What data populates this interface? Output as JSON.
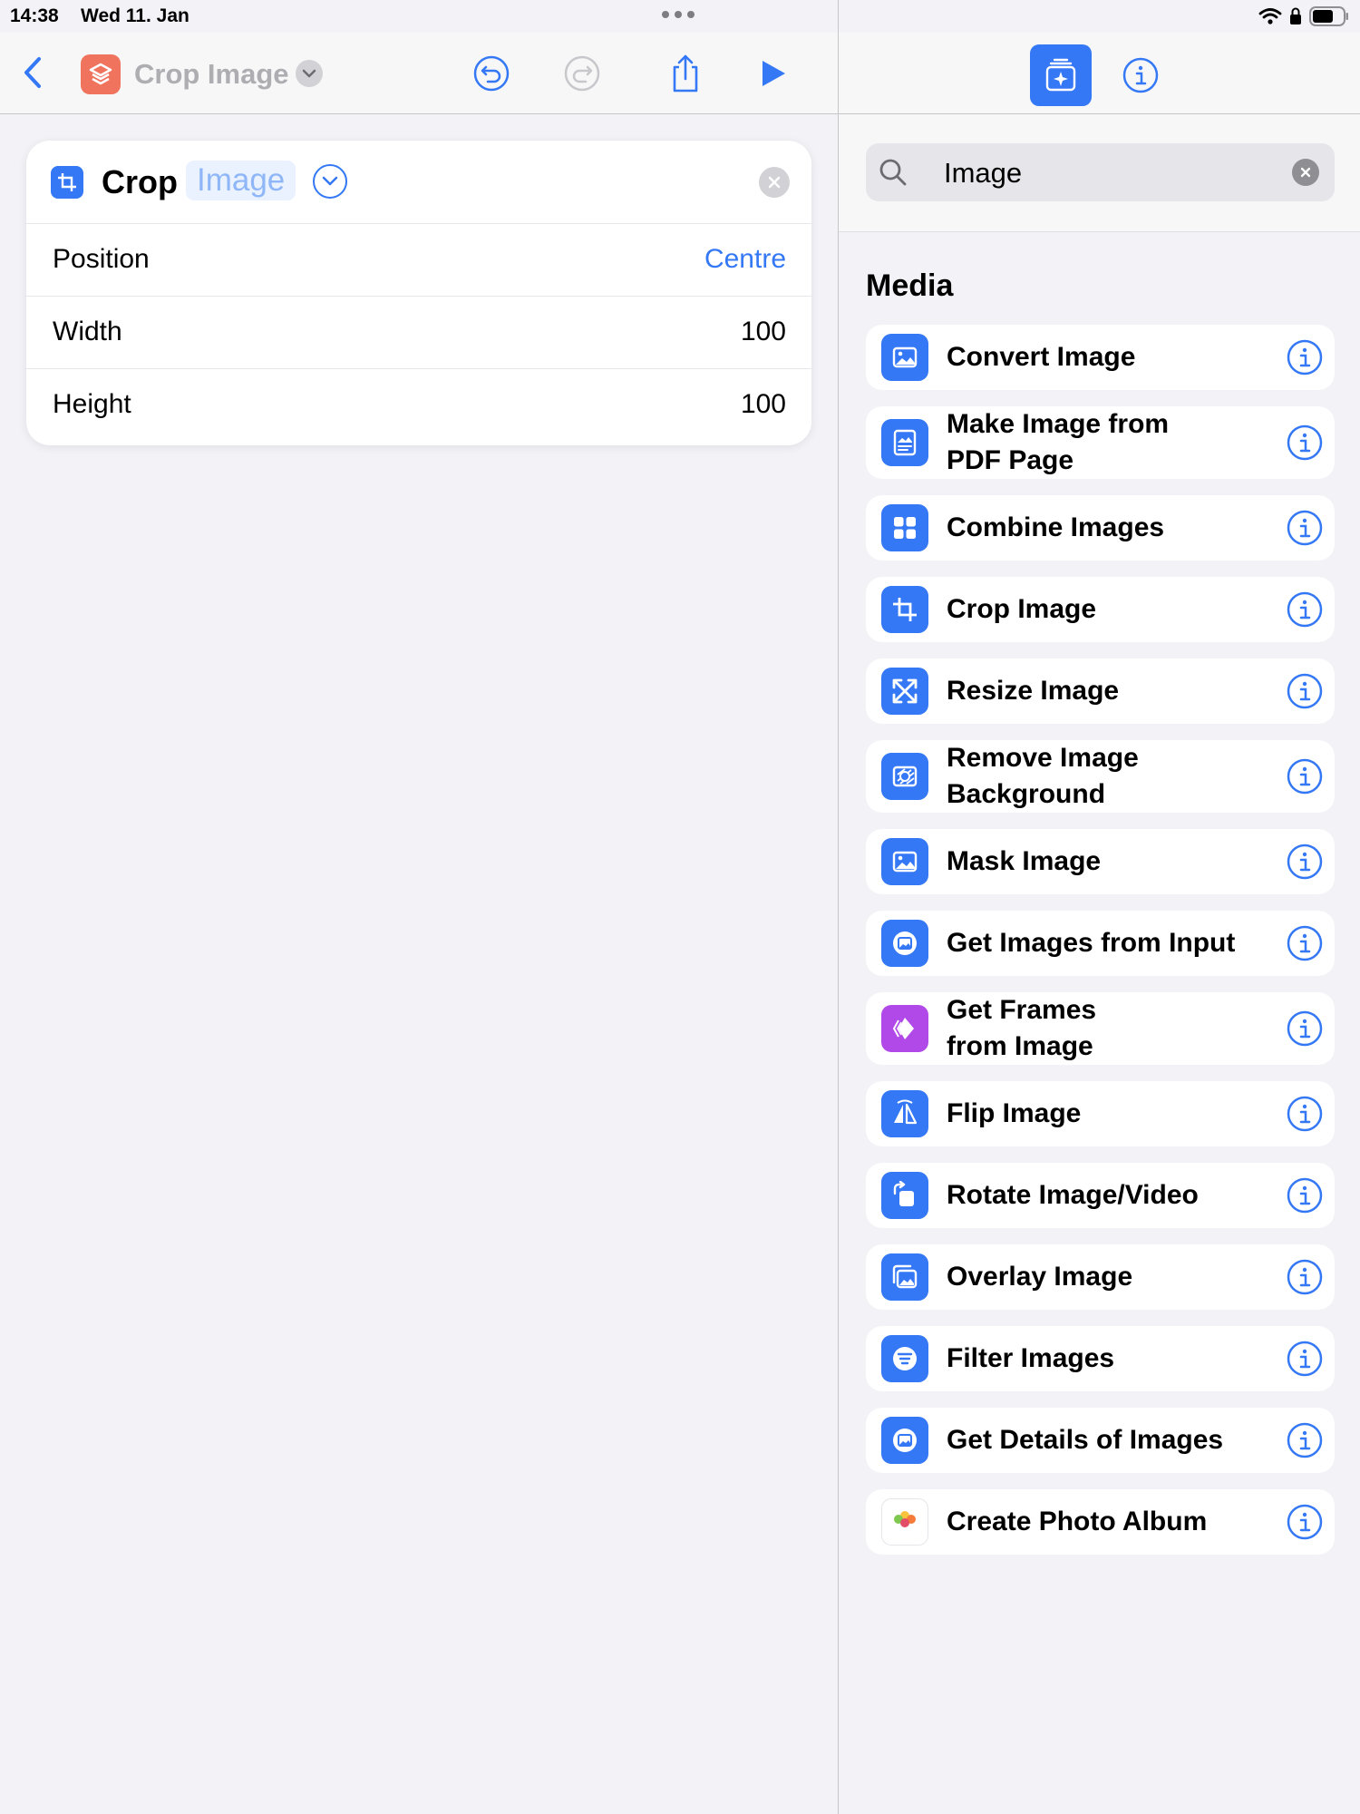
{
  "status": {
    "time": "14:38",
    "date": "Wed 11. Jan"
  },
  "nav": {
    "title": "Crop Image"
  },
  "action_card": {
    "title": "Crop",
    "input_token": "Image",
    "params": [
      {
        "label": "Position",
        "value": "Centre",
        "value_color": "#3478f6"
      },
      {
        "label": "Width",
        "value": "100"
      },
      {
        "label": "Height",
        "value": "100"
      }
    ]
  },
  "search": {
    "query": "Image"
  },
  "section": {
    "title": "Media"
  },
  "actions": [
    {
      "line1": "Convert Image",
      "line2": "",
      "icon": "photo-icon",
      "color": "#3478f6"
    },
    {
      "line1": "Make Image from",
      "line2": "PDF Page",
      "icon": "pdf-image-icon",
      "color": "#3478f6"
    },
    {
      "line1": "Combine Images",
      "line2": "",
      "icon": "grid-icon",
      "color": "#3478f6"
    },
    {
      "line1": "Crop Image",
      "line2": "",
      "icon": "crop-icon",
      "color": "#3478f6"
    },
    {
      "line1": "Resize Image",
      "line2": "",
      "icon": "resize-icon",
      "color": "#3478f6"
    },
    {
      "line1": "Remove Image",
      "line2": "Background",
      "icon": "remove-background-icon",
      "color": "#3478f6"
    },
    {
      "line1": "Mask Image",
      "line2": "",
      "icon": "photo-icon",
      "color": "#3478f6"
    },
    {
      "line1": "Get Images from Input",
      "line2": "",
      "icon": "photo-circle-icon",
      "color": "#3478f6"
    },
    {
      "line1": "Get Frames",
      "line2": "from Image",
      "icon": "frames-icon",
      "color": "#b148e8"
    },
    {
      "line1": "Flip Image",
      "line2": "",
      "icon": "flip-icon",
      "color": "#3478f6"
    },
    {
      "line1": "Rotate Image/Video",
      "line2": "",
      "icon": "rotate-icon",
      "color": "#3478f6"
    },
    {
      "line1": "Overlay Image",
      "line2": "",
      "icon": "overlay-icon",
      "color": "#3478f6"
    },
    {
      "line1": "Filter Images",
      "line2": "",
      "icon": "filter-icon",
      "color": "#3478f6"
    },
    {
      "line1": "Get Details of Images",
      "line2": "",
      "icon": "photo-circle-icon",
      "color": "#3478f6"
    },
    {
      "line1": "Create Photo Album",
      "line2": "",
      "icon": "photos-app-icon",
      "color": "#ffffff"
    }
  ]
}
